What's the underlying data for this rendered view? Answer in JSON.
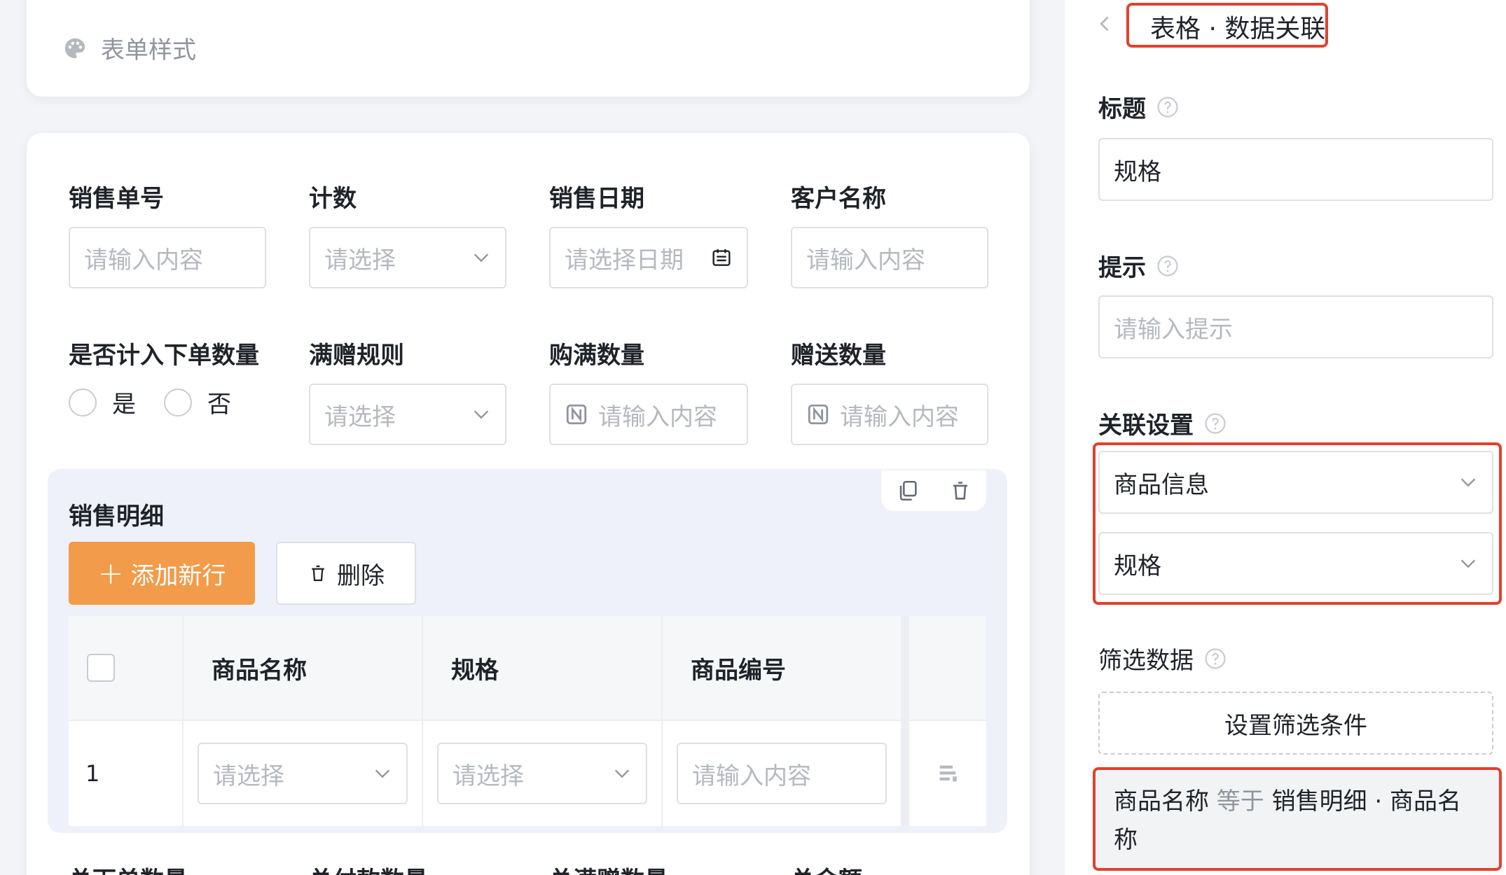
{
  "form_style_label": "表单样式",
  "fields_row1": [
    {
      "label": "销售单号",
      "placeholder": "请输入内容",
      "kind": "text"
    },
    {
      "label": "计数",
      "placeholder": "请选择",
      "kind": "select"
    },
    {
      "label": "销售日期",
      "placeholder": "请选择日期",
      "kind": "date"
    },
    {
      "label": "客户名称",
      "placeholder": "请输入内容",
      "kind": "text"
    }
  ],
  "fields_row2": {
    "count_in_order": {
      "label": "是否计入下单数量",
      "options": [
        "是",
        "否"
      ]
    },
    "gift_rule": {
      "label": "满赠规则",
      "placeholder": "请选择"
    },
    "full_qty": {
      "label": "购满数量",
      "placeholder": "请输入内容"
    },
    "gift_qty": {
      "label": "赠送数量",
      "placeholder": "请输入内容"
    }
  },
  "sales_detail": {
    "title": "销售明细",
    "add_button": "添加新行",
    "delete_button": "删除",
    "columns": [
      "商品名称",
      "规格",
      "商品编号"
    ],
    "row": {
      "index": "1",
      "cells": [
        "请选择",
        "请选择",
        "请输入内容"
      ]
    }
  },
  "bottom_labels": [
    "总下单数量",
    "总付款数量",
    "总满赠数量",
    "总金额"
  ],
  "right_panel": {
    "title": "表格 · 数据关联",
    "title_label": "标题",
    "title_value": "规格",
    "hint_label": "提示",
    "hint_placeholder": "请输入提示",
    "relation_label": "关联设置",
    "relation_table": "商品信息",
    "relation_field": "规格",
    "filter_label": "筛选数据",
    "filter_button": "设置筛选条件",
    "condition": {
      "field": "商品名称",
      "op": "等于",
      "value": "销售明细 · 商品名称"
    }
  },
  "colors": {
    "accent": "#f29b4a",
    "highlight": "#e0412f"
  }
}
